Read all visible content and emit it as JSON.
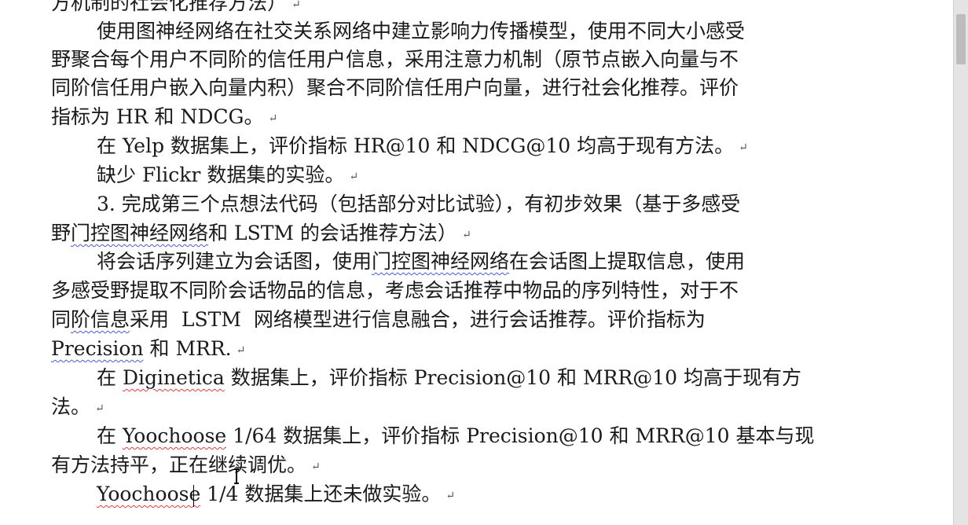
{
  "document": {
    "lines": [
      {
        "segments": [
          "方机制的社会化推荐方法）"
        ],
        "mark": "↵"
      },
      {
        "segments": [
          "使用图神经网络在社交关系网络中建立影响力传播模型，使用不同大小感受"
        ],
        "mark": ""
      },
      {
        "segments": [
          "野聚合每个用户不同阶的信任用户信息，采用注意力机制（原节点嵌入向量与不"
        ],
        "mark": ""
      },
      {
        "segments": [
          "同阶信任用户嵌入向量内积）聚合不同阶信任用户向量，进行社会化推荐。评价"
        ],
        "mark": ""
      },
      {
        "segments": [
          "指标为 HR 和 NDCG。"
        ],
        "mark": "↵"
      },
      {
        "segments": [
          "在 Yelp 数据集上，评价指标 HR@10 和 NDCG@10 均高于现有方法。"
        ],
        "mark": "↵"
      },
      {
        "segments": [
          "缺少 Flickr 数据集的实验。"
        ],
        "mark": "↵"
      },
      {
        "segments": [
          "3. 完成第三个点想法代码（包括部分对比试验），有初步效果（基于多感受"
        ],
        "mark": ""
      },
      {
        "segments": [
          "野",
          "门控图神经网络",
          "和 LSTM 的会话推荐方法）"
        ],
        "mark": "↵"
      },
      {
        "segments": [
          "将会话序列建立为会话图，使用",
          "门控图神经网络",
          "在会话图上提取信息，使用"
        ],
        "mark": ""
      },
      {
        "segments": [
          "多感受野提取不同阶会话物品的信息，考虑会话推荐中物品的序列特性，对于不"
        ],
        "mark": ""
      },
      {
        "segments": [
          "同",
          "阶信息",
          "采用  LSTM  网络模型进行信息融合，进行会话推荐。评价指标为"
        ],
        "mark": ""
      },
      {
        "segments": [
          "Precision",
          " 和 MRR."
        ],
        "mark": "↵"
      },
      {
        "segments": [
          "在 ",
          "Diginetica",
          " 数据集上，评价指标 Precision@10 和 MRR@10 均高于现有方"
        ],
        "mark": ""
      },
      {
        "segments": [
          "法。"
        ],
        "mark": "↵"
      },
      {
        "segments": [
          "在 ",
          "Yoochoose",
          " 1/64 数据集上，评价指标 Precision@10 和 MRR@10 基本与现"
        ],
        "mark": ""
      },
      {
        "segments": [
          "有方法持平，正在继续调优。"
        ],
        "mark": "↵"
      },
      {
        "segments": [
          "Yoochoose",
          " 1/4 数据集上还未做实验。"
        ],
        "mark": "↵"
      }
    ]
  },
  "colors": {
    "page": "#ffffff",
    "text": "#1a1a1a",
    "grammar_squiggle": "#4a5adf",
    "spelling_squiggle": "#e04040",
    "scrollbar": "#e4e4e4"
  },
  "icons": {
    "cursor": "text-ibeam-icon"
  }
}
